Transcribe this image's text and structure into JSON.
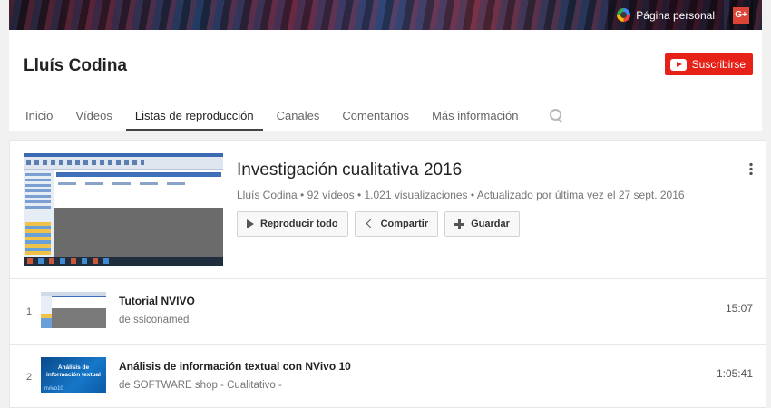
{
  "banner": {
    "personal_label": "Página personal",
    "gplus_label": "G+"
  },
  "channel": {
    "name": "Lluís Codina",
    "subscribe_label": "Suscribirse"
  },
  "tabs": [
    {
      "label": "Inicio",
      "active": false
    },
    {
      "label": "Vídeos",
      "active": false
    },
    {
      "label": "Listas de reproducción",
      "active": true
    },
    {
      "label": "Canales",
      "active": false
    },
    {
      "label": "Comentarios",
      "active": false
    },
    {
      "label": "Más información",
      "active": false
    }
  ],
  "playlist": {
    "title": "Investigación cualitativa 2016",
    "meta": "Lluís Codina • 92 vídeos • 1.021 visualizaciones • Actualizado por última vez el 27 sept. 2016",
    "play_all_label": "Reproducir todo",
    "share_label": "Compartir",
    "save_label": "Guardar"
  },
  "videos": [
    {
      "index": "1",
      "title": "Tutorial NVIVO",
      "author": "de ssiconamed",
      "duration": "15:07"
    },
    {
      "index": "2",
      "title": "Análisis de información textual con NVivo 10",
      "author": "de SOFTWARE shop - Cualitativo -",
      "duration": "1:05:41",
      "thumb_text": "Análisis de información textual",
      "thumb_brand": "nvivo10"
    }
  ],
  "colors": {
    "subscribe_red": "#e62117",
    "gplus_red": "#db4437"
  }
}
